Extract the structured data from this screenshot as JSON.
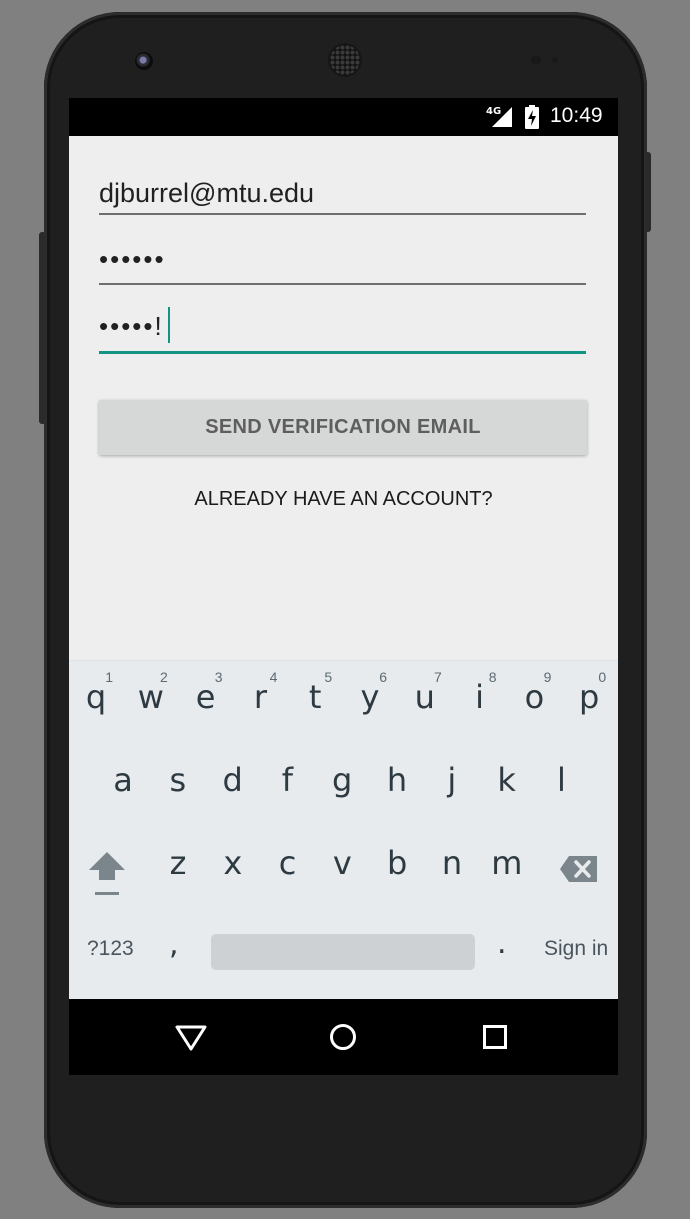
{
  "status_bar": {
    "network": "4G",
    "time": "10:49"
  },
  "form": {
    "email_value": "djburrel@mtu.edu",
    "password_value": "••••••",
    "confirm_password_value": "•••••!",
    "send_button_label": "SEND VERIFICATION EMAIL",
    "account_link_label": "ALREADY HAVE AN ACCOUNT?"
  },
  "keyboard": {
    "row1": [
      {
        "char": "q",
        "num": "1"
      },
      {
        "char": "w",
        "num": "2"
      },
      {
        "char": "e",
        "num": "3"
      },
      {
        "char": "r",
        "num": "4"
      },
      {
        "char": "t",
        "num": "5"
      },
      {
        "char": "y",
        "num": "6"
      },
      {
        "char": "u",
        "num": "7"
      },
      {
        "char": "i",
        "num": "8"
      },
      {
        "char": "o",
        "num": "9"
      },
      {
        "char": "p",
        "num": "0"
      }
    ],
    "row2": [
      "a",
      "s",
      "d",
      "f",
      "g",
      "h",
      "j",
      "k",
      "l"
    ],
    "row3": [
      "z",
      "x",
      "c",
      "v",
      "b",
      "n",
      "m"
    ],
    "symbols_label": "?123",
    "comma": ",",
    "period": ".",
    "action_label": "Sign in",
    "icons": {
      "shift": "shift-icon",
      "backspace": "backspace-icon"
    }
  },
  "nav_bar": {
    "icons": [
      "back-icon",
      "home-icon",
      "recents-icon"
    ]
  },
  "colors": {
    "accent": "#129383",
    "app_background": "#eeeeee",
    "keyboard_background": "#e8ebee",
    "button_background": "#d6d7d7"
  }
}
